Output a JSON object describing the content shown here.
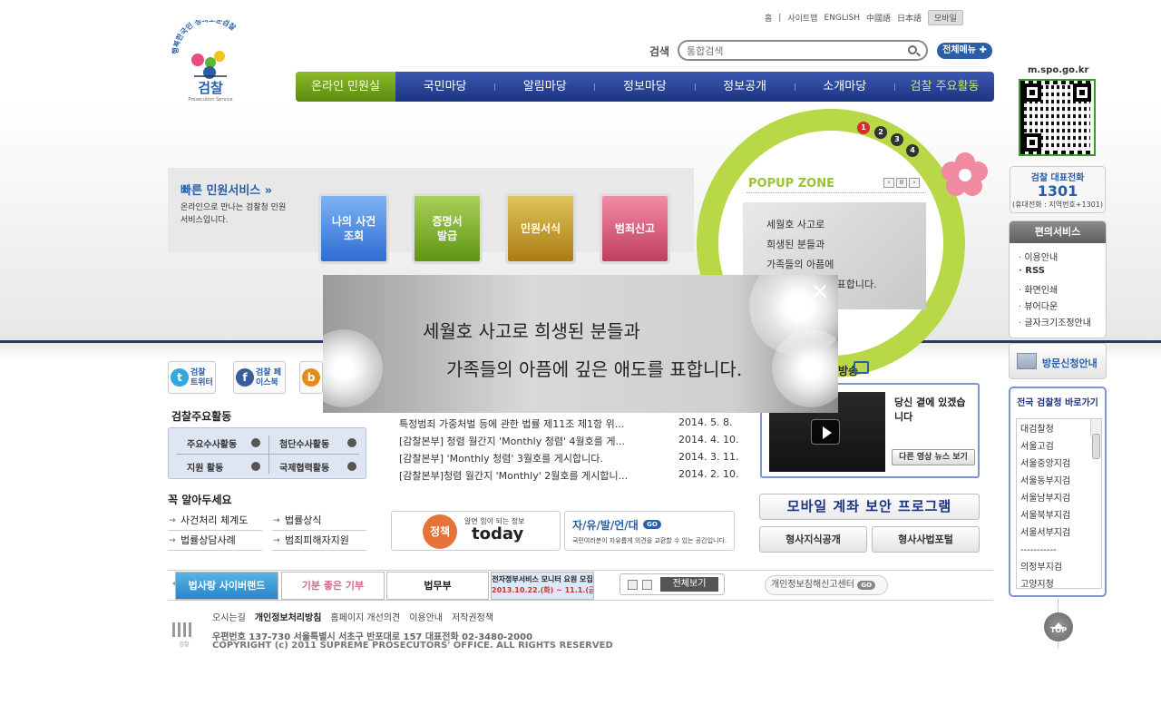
{
  "top_links": [
    "홈",
    "사이트맵",
    "ENGLISH",
    "中國語",
    "日本語"
  ],
  "mobile_btn": "모바일",
  "logo": {
    "slogan": "행복한국민 정의로운검찰",
    "name": "검찰",
    "sub": "Prosecution Service"
  },
  "search": {
    "label": "검색",
    "placeholder": "통합검색"
  },
  "allmenu_label": "전체메뉴",
  "gnb": [
    "온라인 민원실",
    "국민마당",
    "알림마당",
    "정보마당",
    "정보공개",
    "소개마당",
    "검찰 주요활동"
  ],
  "qr_label": "m.spo.go.kr",
  "tel": {
    "title": "검찰 대표전화",
    "number": "1301",
    "note": "(휴대전화 : 지역번호+1301)"
  },
  "convenience": {
    "title": "편의서비스",
    "items": [
      "이용안내",
      "RSS",
      "화면인쇄",
      "뷰어다운",
      "글자크기조정안내"
    ]
  },
  "visit_label": "방문신청안내",
  "prosecutors": {
    "title": "전국 검찰청 바로가기",
    "items": [
      "대검찰청",
      "서울고검",
      "서울중앙지검",
      "서울동부지검",
      "서울남부지검",
      "서울북부지검",
      "서울서부지검",
      "-----------",
      "의정부지검",
      "고양지청"
    ]
  },
  "quick": {
    "title": "빠른 민원서비스",
    "desc": "온라인으로 만나는 검찰청 민원 서비스입니다.",
    "buttons": [
      "나의 사건 조회",
      "증명서 발급",
      "민원서식",
      "범죄신고"
    ]
  },
  "popup": {
    "title": "POPUP ZONE",
    "pages": [
      "1",
      "2",
      "3",
      "4"
    ],
    "controls": [
      "‹",
      "II",
      "›"
    ],
    "image_text": [
      "세월호 사고로",
      "희생된 분들과",
      "가족들의 아픔에",
      "깊은 애도를 표합니다."
    ]
  },
  "overlay": {
    "line1": "세월호 사고로 희생된 분들과",
    "line2": "가족들의 아픔에 깊은 애도를 표합니다."
  },
  "sns": [
    {
      "icon": "t",
      "label": "검찰 트위터",
      "color": "#33a7e0"
    },
    {
      "icon": "f",
      "label": "검찰 페이스북",
      "color": "#3b5a9a"
    },
    {
      "icon": "b",
      "label": "",
      "color": "#e88a1a"
    }
  ],
  "activity": {
    "title": "검찰주요활동",
    "items": [
      "주요수사활동",
      "첨단수사활동",
      "지원 활동",
      "국제협력활동"
    ]
  },
  "know": {
    "title": "꼭 알아두세요",
    "items": [
      "사건처리 체계도",
      "법률상식",
      "법률상담사례",
      "범죄피해자지원"
    ]
  },
  "news": [
    {
      "title": "특정범죄 가중처벌 등에 관한 법률 제11조 제1항 위...",
      "date": "2014. 5. 8."
    },
    {
      "title": "[감찰본부] 청렴 월간지 'Monthly 청렴' 4월호를 게...",
      "date": "2014. 4. 10."
    },
    {
      "title": "[감찰본부] 'Monthly 청렴' 3월호를 게시합니다.",
      "date": "2014. 3. 11."
    },
    {
      "title": "[감찰본부]청렴 월간지 'Monthly' 2월호를 게시합니...",
      "date": "2014. 2. 10."
    }
  ],
  "banners_mid": {
    "b1_small": "알면 힘이 되는 정보",
    "b1_big": "today",
    "b1_logo": "정책",
    "b2_title": "자/유/발/언/대",
    "b2_desc": "국민여러분이 자유롭게 의견을 교환할 수 있는 공간입니다."
  },
  "video": {
    "section": "방송",
    "title": "당신 곁에 있겠습니다",
    "more": "다른 영상 뉴스 보기"
  },
  "mobile_program": "모바일 계좌 보안 프로그램",
  "small_buttons": [
    "형사지식공개",
    "형사사법포털"
  ],
  "strip_banners": [
    "법사랑 사이버랜드",
    "기분 좋은 기부",
    "법무부",
    "전자정부서비스 모니터 요원 모집"
  ],
  "strip_banner_date": "2013.10.22.(화) ~ 11.1.(금)",
  "view_all": "전체보기",
  "privacy_center": "개인정보침해신고센터",
  "footer": {
    "links": [
      "오시는길",
      "개인정보처리방침",
      "홈페이지 개선의견",
      "이용안내",
      "저작권정책"
    ],
    "addr": "우편번호 137-730 서울특별시 서초구 반포대로 157 대표전화 02-3480-2000",
    "copy": "COPYRIGHT (c) 2011 SUPREME PROSECUTORS' OFFICE. ALL RIGHTS RESERVED"
  },
  "top_label": "TOP",
  "go_label": "GO"
}
